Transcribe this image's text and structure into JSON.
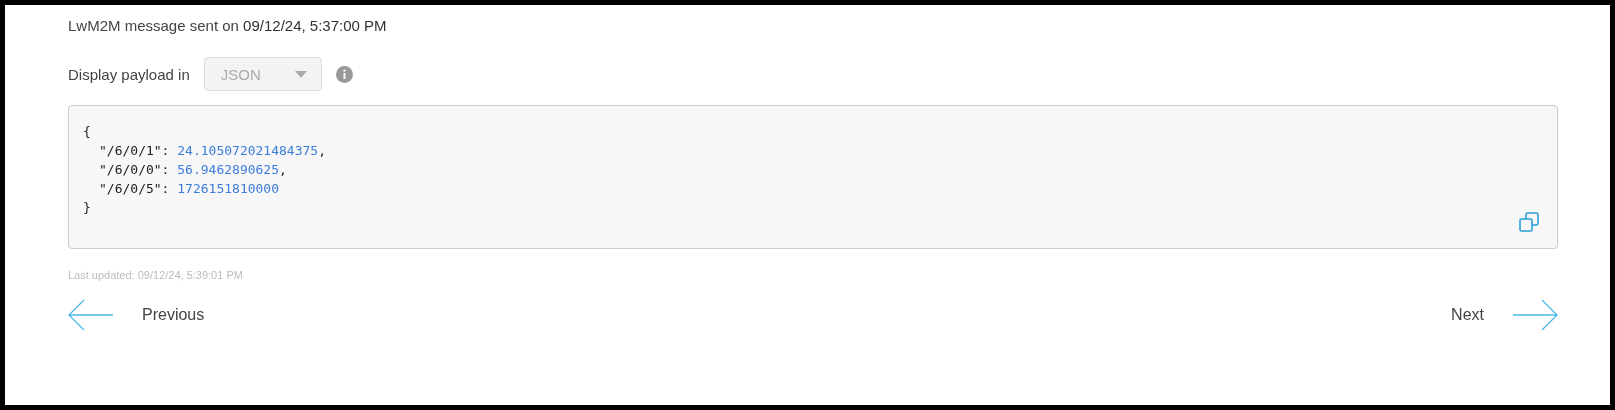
{
  "header": {
    "text": "LwM2M message sent on",
    "timestamp": "09/12/24, 5:37:00 PM"
  },
  "display": {
    "label": "Display payload in",
    "select": {
      "value": "JSON",
      "disabled": true
    }
  },
  "payload": {
    "open": "{",
    "close": "}",
    "lines": [
      {
        "key": "\"/6/0/1\":",
        "value": "24.105072021484375",
        "punct": ","
      },
      {
        "key": "\"/6/0/0\":",
        "value": "56.9462890625",
        "punct": ","
      },
      {
        "key": "\"/6/0/5\":",
        "value": "1726151810000"
      }
    ]
  },
  "last_updated": "Last updated: 09/12/24, 5:39:01 PM",
  "nav": {
    "previous": "Previous",
    "next": "Next"
  }
}
